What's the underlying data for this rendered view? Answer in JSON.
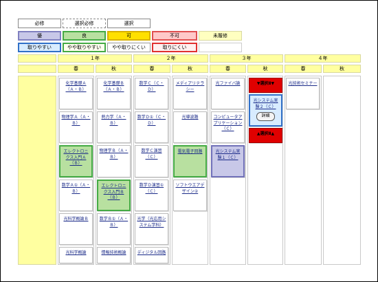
{
  "legend": {
    "row1": [
      "必修",
      "選択必修",
      "選択"
    ],
    "row2": [
      "優",
      "良",
      "可",
      "不可",
      "未履修"
    ],
    "row3": [
      "取りやすい",
      "やや取りやすい",
      "やや取りにくい",
      "取りにくい",
      ""
    ]
  },
  "years": [
    "１年",
    "２年",
    "３年",
    "４年"
  ],
  "terms": [
    "春",
    "秋",
    "春",
    "秋",
    "春",
    "秋",
    "春",
    "秋"
  ],
  "courses": {
    "y1s": [
      "化学基礎Ａ（Ａ・Ｂ）",
      "物理学Ａ（Ａ・Ｂ）",
      "エレクトロニクス入門Ａ（Ｂ）",
      "数学Ａ①（Ａ・Ｂ）",
      "光科学概論Ｂ",
      "光科学概論"
    ],
    "y1a": [
      "化学基礎Ｂ（Ａ・Ｂ）",
      "熱力学（Ａ・Ｂ）",
      "物理学Ｂ（Ａ・Ｂ）",
      "エレクトロニクス入門Ｂ（Ｂ）",
      "数学Ｂ①（Ａ・Ｂ）",
      "情報技術概論"
    ],
    "y2s": [
      "数学Ｃ（Ｃ・Ｄ）",
      "数学Ｄ①（Ｃ・Ｄ）",
      "数学Ｃ演習（Ｃ）",
      "数学Ｄ演習①（Ｃ）",
      "光学（光応用システム学科）",
      "ディジタル回路"
    ],
    "y2a": [
      "メディアリテラシー",
      "光導波路",
      "電気電子回路",
      "ソフトウエアデザイン②"
    ],
    "y3s": [
      "光ファイバ論",
      "コンピュータアプリケーション（Ｃ）",
      "光システム実験１（Ｃ）"
    ],
    "y3a": [
      "▼選択Ⅱ▼",
      "光システム実験２（Ｃ）",
      "▲選択Ⅱ▲"
    ],
    "y3a_detail": "詳細",
    "y4s": [
      "光技術セミナー"
    ]
  },
  "colors": {
    "good": "#b8e0a0",
    "excellent": "#c8c8e8",
    "easy": "#d8ecff",
    "selection_marker": "#e00000",
    "header": "#ffffa0"
  }
}
